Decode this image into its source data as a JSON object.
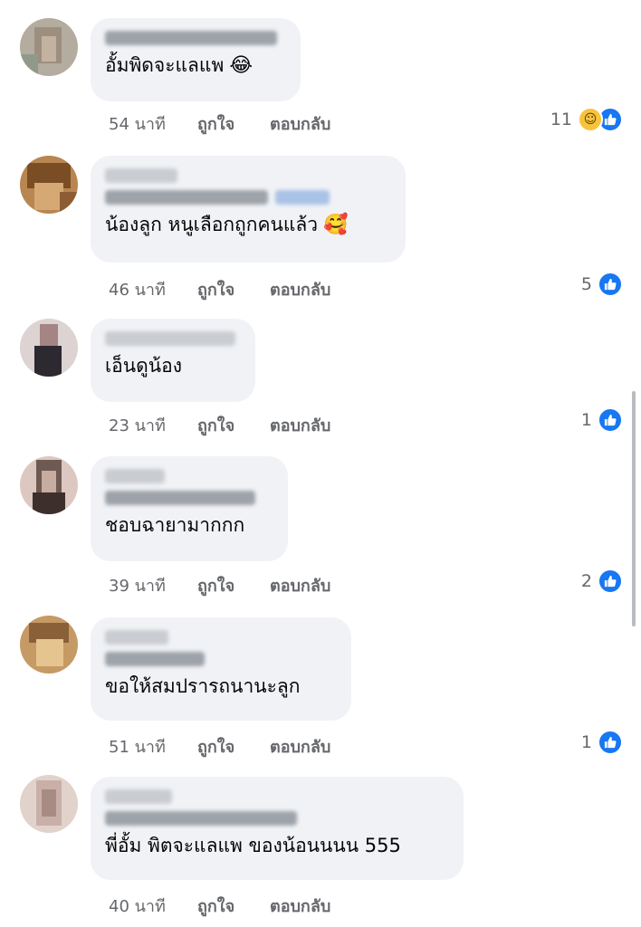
{
  "colors": {
    "bubble_bg": "#f0f2f5",
    "meta_text": "#65676b",
    "like_blue": "#1877f2",
    "haha_yellow": "#f7c33c"
  },
  "comments": [
    {
      "text": "อั้มพิดจะแลแพ",
      "emoji": "😂",
      "time": "54 นาที",
      "like_label": "ถูกใจ",
      "reply_label": "ตอบกลับ",
      "reaction_count": "11",
      "reactions": [
        "haha-icon",
        "like-icon"
      ],
      "avatar_palette": [
        "#a9b0a2",
        "#8f9a8c",
        "#c0b4a4",
        "#b3a896"
      ]
    },
    {
      "text": "น้องลูก หนูเลือกถูกคนแล้ว",
      "emoji": "🥰",
      "time": "46 นาที",
      "like_label": "ถูกใจ",
      "reply_label": "ตอบกลับ",
      "reaction_count": "5",
      "reactions": [
        "like-icon"
      ],
      "avatar_palette": [
        "#8a5a2b",
        "#c28a50",
        "#5e3b1f",
        "#d8b080"
      ]
    },
    {
      "text": "เอ็นดูน้อง",
      "emoji": "",
      "time": "23 นาที",
      "like_label": "ถูกใจ",
      "reply_label": "ตอบกลับ",
      "reaction_count": "1",
      "reactions": [
        "like-icon"
      ],
      "avatar_palette": [
        "#2c2a30",
        "#b89a9a",
        "#e0d6d6",
        "#554b52"
      ]
    },
    {
      "text": "ชอบฉายามากกก",
      "emoji": "",
      "time": "39 นาที",
      "like_label": "ถูกใจ",
      "reply_label": "ตอบกลับ",
      "reaction_count": "2",
      "reactions": [
        "like-icon"
      ],
      "avatar_palette": [
        "#6e5a52",
        "#c7aca0",
        "#3d2f2c",
        "#dcc8c0"
      ]
    },
    {
      "text": "ขอให้สมปรารถนานะลูก",
      "emoji": "",
      "time": "51 นาที",
      "like_label": "ถูกใจ",
      "reply_label": "ตอบกลับ",
      "reaction_count": "1",
      "reactions": [
        "like-icon"
      ],
      "avatar_palette": [
        "#b08050",
        "#d4a670",
        "#8a6038",
        "#e6c490"
      ]
    },
    {
      "text": "พี่อั้ม พิตจะแลแพ ของน้อนนนน 555",
      "emoji": "",
      "time": "40 นาที",
      "like_label": "ถูกใจ",
      "reply_label": "ตอบกลับ",
      "reaction_count": "",
      "reactions": [],
      "avatar_palette": [
        "#c8b0a8",
        "#e2d2cc",
        "#a88c84",
        "#f0e4e0"
      ]
    }
  ]
}
